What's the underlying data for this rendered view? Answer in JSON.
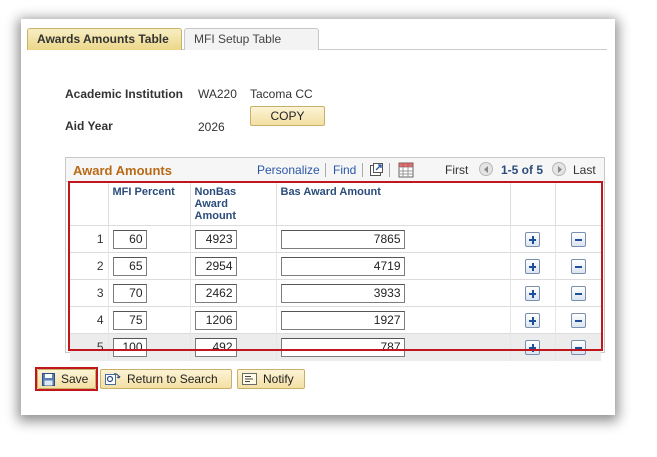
{
  "tabs": [
    {
      "label": "Awards Amounts Table",
      "active": true
    },
    {
      "label": "MFI Setup Table",
      "active": false
    }
  ],
  "header": {
    "institution_label": "Academic Institution",
    "institution_code": "WA220",
    "institution_name": "Tacoma CC",
    "aid_year_label": "Aid Year",
    "aid_year_value": "2026",
    "copy_label": "COPY"
  },
  "grid": {
    "title": "Award Amounts",
    "personalize": "Personalize",
    "find": "Find",
    "first": "First",
    "range": "1-5 of 5",
    "last": "Last",
    "columns": [
      "MFI Percent",
      "NonBas Award Amount",
      "Bas Award Amount"
    ],
    "rows": [
      {
        "n": "1",
        "mfi": "60",
        "nonbas": "4923",
        "bas": "7865"
      },
      {
        "n": "2",
        "mfi": "65",
        "nonbas": "2954",
        "bas": "4719"
      },
      {
        "n": "3",
        "mfi": "70",
        "nonbas": "2462",
        "bas": "3933"
      },
      {
        "n": "4",
        "mfi": "75",
        "nonbas": "1206",
        "bas": "1927"
      },
      {
        "n": "5",
        "mfi": "100",
        "nonbas": "492",
        "bas": "787"
      }
    ]
  },
  "footer": {
    "save": "Save",
    "return": "Return to Search",
    "notify": "Notify"
  },
  "colors": {
    "accent_tab": "#ecd789",
    "grid_title": "#b96a16",
    "link": "#2a56a8",
    "highlight": "#c0171c"
  }
}
